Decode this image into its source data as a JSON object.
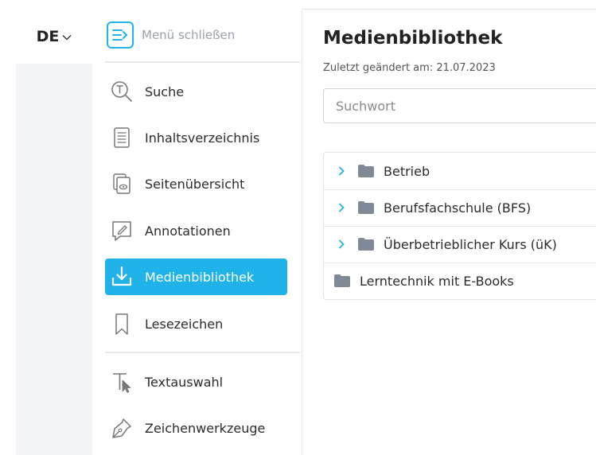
{
  "language": {
    "label": "DE"
  },
  "sidebar": {
    "close_label": "Menü schließen",
    "items": [
      {
        "label": "Suche",
        "icon": "search-text-icon"
      },
      {
        "label": "Inhaltsverzeichnis",
        "icon": "table-of-contents-icon"
      },
      {
        "label": "Seitenübersicht",
        "icon": "page-overview-icon"
      },
      {
        "label": "Annotationen",
        "icon": "annotation-icon"
      },
      {
        "label": "Medienbibliothek",
        "icon": "download-icon",
        "active": true
      },
      {
        "label": "Lesezeichen",
        "icon": "bookmark-icon"
      },
      {
        "label": "Textauswahl",
        "icon": "text-select-icon"
      },
      {
        "label": "Zeichenwerkzeuge",
        "icon": "pen-icon"
      }
    ]
  },
  "main": {
    "title": "Medienbibliothek",
    "last_modified": "Zuletzt geändert am: 21.07.2023",
    "search_placeholder": "Suchwort",
    "folders": [
      {
        "label": "Betrieb",
        "expandable": true
      },
      {
        "label": "Berufsfachschule (BFS)",
        "expandable": true
      },
      {
        "label": "Überbetrieblicher Kurs (üK)",
        "expandable": true
      },
      {
        "label": "Lerntechnik mit E-Books",
        "expandable": false
      }
    ]
  },
  "colors": {
    "accent": "#1fb3ea",
    "folder": "#7f8a96",
    "sidebar_bg": "#f2f4f8"
  }
}
